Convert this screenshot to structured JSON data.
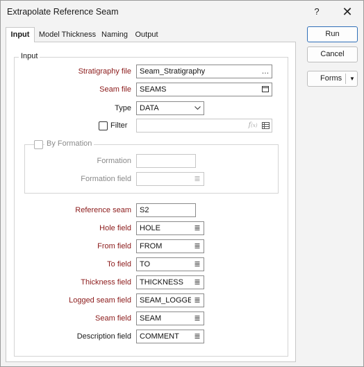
{
  "window": {
    "title": "Extrapolate Reference Seam",
    "help_glyph": "?",
    "close_glyph": "✕"
  },
  "tabs": [
    {
      "label": "Input",
      "active": true
    },
    {
      "label": "Model Thickness",
      "active": false
    },
    {
      "label": "Naming",
      "active": false
    },
    {
      "label": "Output",
      "active": false
    }
  ],
  "buttons": {
    "run": "Run",
    "cancel": "Cancel",
    "forms": "Forms"
  },
  "input_group": {
    "legend": "Input",
    "stratigraphy_file": {
      "label": "Stratigraphy file",
      "value": "Seam_Stratigraphy"
    },
    "seam_file": {
      "label": "Seam file",
      "value": "SEAMS"
    },
    "type": {
      "label": "Type",
      "value": "DATA"
    },
    "filter": {
      "label": "Filter",
      "value": "",
      "checked": false
    }
  },
  "by_formation": {
    "legend": "By Formation",
    "checked": false,
    "formation": {
      "label": "Formation",
      "value": ""
    },
    "formation_field": {
      "label": "Formation field",
      "value": ""
    }
  },
  "fields": {
    "reference_seam": {
      "label": "Reference seam",
      "value": "S2"
    },
    "hole_field": {
      "label": "Hole field",
      "value": "HOLE"
    },
    "from_field": {
      "label": "From field",
      "value": "FROM"
    },
    "to_field": {
      "label": "To field",
      "value": "TO"
    },
    "thickness_field": {
      "label": "Thickness field",
      "value": "THICKNESS"
    },
    "logged_seam_field": {
      "label": "Logged seam field",
      "value": "SEAM_LOGGED"
    },
    "seam_field": {
      "label": "Seam field",
      "value": "SEAM"
    },
    "description_field": {
      "label": "Description field",
      "value": "COMMENT"
    }
  },
  "icons": {
    "browse": "browse-icon",
    "list": "list-icon",
    "function": "function-icon",
    "grid": "grid-icon",
    "dropdown": "chevron-down-icon"
  }
}
